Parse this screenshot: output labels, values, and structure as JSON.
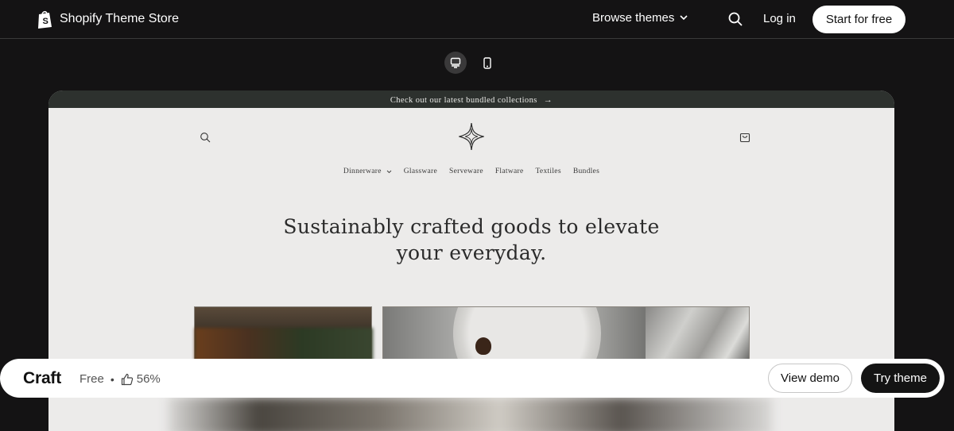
{
  "header": {
    "brand_name": "Shopify Theme Store",
    "browse_label": "Browse themes",
    "login_label": "Log in",
    "start_label": "Start for free",
    "icons": [
      "shopify-bag-icon",
      "chevron-down-icon",
      "search-icon"
    ]
  },
  "device_toggle": {
    "desktop_icon": "desktop-icon",
    "mobile_icon": "mobile-icon",
    "selected": "desktop"
  },
  "preview": {
    "announcement": "Check out our latest bundled collections",
    "announcement_arrow": "→",
    "nav": [
      {
        "label": "Dinnerware",
        "has_dropdown": true
      },
      {
        "label": "Glassware",
        "has_dropdown": false
      },
      {
        "label": "Serveware",
        "has_dropdown": false
      },
      {
        "label": "Flatware",
        "has_dropdown": false
      },
      {
        "label": "Textiles",
        "has_dropdown": false
      },
      {
        "label": "Bundles",
        "has_dropdown": false
      }
    ],
    "hero_line1": "Sustainably crafted goods to elevate",
    "hero_line2": "your everyday."
  },
  "theme_bar": {
    "name": "Craft",
    "price": "Free",
    "separator": "•",
    "rating": "56%",
    "view_demo_label": "View demo",
    "try_theme_label": "Try theme"
  },
  "colors": {
    "page_bg": "#141314",
    "preview_bg": "#ecebea",
    "announcement_bg": "#2d312e",
    "primary_button_bg": "#141414"
  }
}
